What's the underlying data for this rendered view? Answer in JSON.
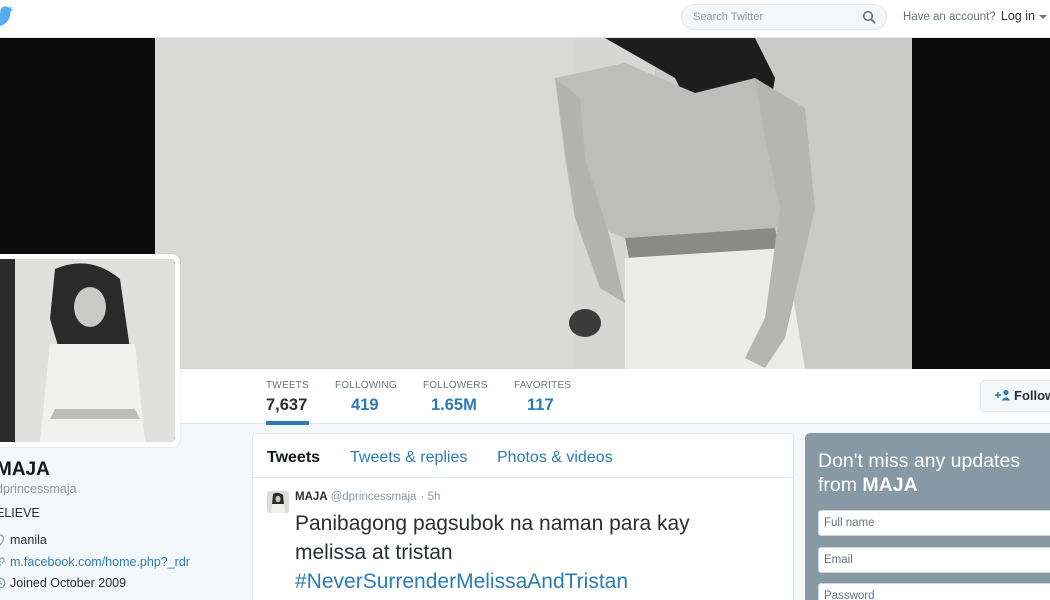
{
  "brand": {
    "color": "#55acee",
    "link_color": "#2b7bb9",
    "logo_icon": "twitter-bird-icon"
  },
  "topnav": {
    "search_placeholder": "Search Twitter",
    "search_icon": "magnifier-icon",
    "account_prompt": "Have an account?",
    "login_label": "Log in"
  },
  "stats": [
    {
      "label": "TWEETS",
      "value": "7,637"
    },
    {
      "label": "FOLLOWING",
      "value": "419"
    },
    {
      "label": "FOLLOWERS",
      "value": "1.65M"
    },
    {
      "label": "FAVORITES",
      "value": "117"
    }
  ],
  "follow_button": {
    "label": "Follow",
    "icon": "add-user-icon"
  },
  "profile": {
    "name": "MAJA",
    "handle": "dprincessmaja",
    "bio": "ELIEVE",
    "location": "manila",
    "location_icon": "location-pin-icon",
    "website": "m.facebook.com/home.php?_rdr",
    "website_icon": "link-icon",
    "joined": "Joined October 2009",
    "joined_icon": "calendar-icon"
  },
  "timeline": {
    "tabs": [
      "Tweets",
      "Tweets & replies",
      "Photos & videos"
    ],
    "tweet": {
      "author": "MAJA",
      "handle": "@dprincessmaja",
      "time": "· 5h",
      "text_line1": "Panibagong pagsubok na naman para kay",
      "text_line2": "melissa at tristan",
      "hashtag": "#NeverSurrenderMelissaAndTristan"
    }
  },
  "signup": {
    "heading_prefix": "Don't miss any updates from",
    "heading_name": "MAJA",
    "fullname_placeholder": "Full name",
    "email_placeholder": "Email",
    "password_placeholder": "Password"
  }
}
